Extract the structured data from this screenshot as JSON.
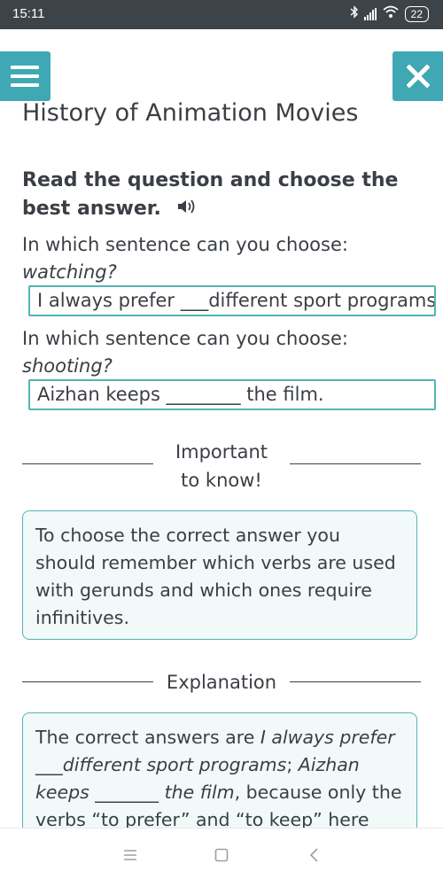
{
  "status_bar": {
    "time": "15:11",
    "battery": "22",
    "icons": [
      "bluetooth-icon",
      "signal-icon",
      "wifi-icon",
      "battery-icon"
    ]
  },
  "header": {
    "menu_icon": "hamburger-menu-icon",
    "close_icon": "close-icon",
    "title": "History of Animation Movies"
  },
  "instruction": {
    "text": "Read the question and choose the best answer.",
    "audio_icon": "speaker-icon"
  },
  "questions": [
    {
      "lead": "In which sentence can you choose:",
      "word": "watching?",
      "answer": "I always prefer ___different sport programs"
    },
    {
      "lead": "In which sentence can you choose:",
      "word": "shooting?",
      "answer": "Aizhan keeps ________ the film."
    }
  ],
  "important": {
    "label_line1": "Important",
    "label_line2": "to know!",
    "text": "To choose the correct answer you should remember which verbs are used with gerunds and which ones require infinitives."
  },
  "explanation": {
    "label": "Explanation",
    "part1": "The correct answers are ",
    "ans1": "I always prefer ___different sport programs",
    "sep": "; ",
    "ans2": "Aizhan keeps _______ the film",
    "part2": ", because only the verbs “to prefer” and “to keep” here"
  },
  "colors": {
    "accent": "#3fa8b4",
    "box_border": "#55b3b3",
    "note_bg": "#f1faf8",
    "status_bar": "#3d4449",
    "text": "#3a3f45"
  },
  "nav_icons": [
    "recent-apps-icon",
    "home-icon",
    "back-icon"
  ]
}
